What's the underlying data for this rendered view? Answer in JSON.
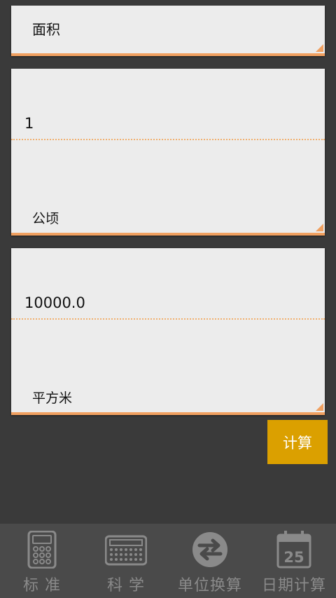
{
  "category": {
    "label": "面积"
  },
  "input": {
    "value": "1",
    "unit": "公顷"
  },
  "output": {
    "value": "10000.0",
    "unit": "平方米"
  },
  "calculate_button": {
    "label": "计算"
  },
  "tabs": [
    {
      "label": "标 准",
      "icon": "calculator-icon"
    },
    {
      "label": "科 学",
      "icon": "scientific-calculator-icon"
    },
    {
      "label": "单位换算",
      "icon": "swap-arrows-icon"
    },
    {
      "label": "日期计算",
      "icon": "calendar-icon",
      "icon_text": "25"
    }
  ],
  "colors": {
    "accent_orange": "#f0a060",
    "button": "#dba000",
    "background": "#3a3a3a",
    "card": "#ececec"
  }
}
